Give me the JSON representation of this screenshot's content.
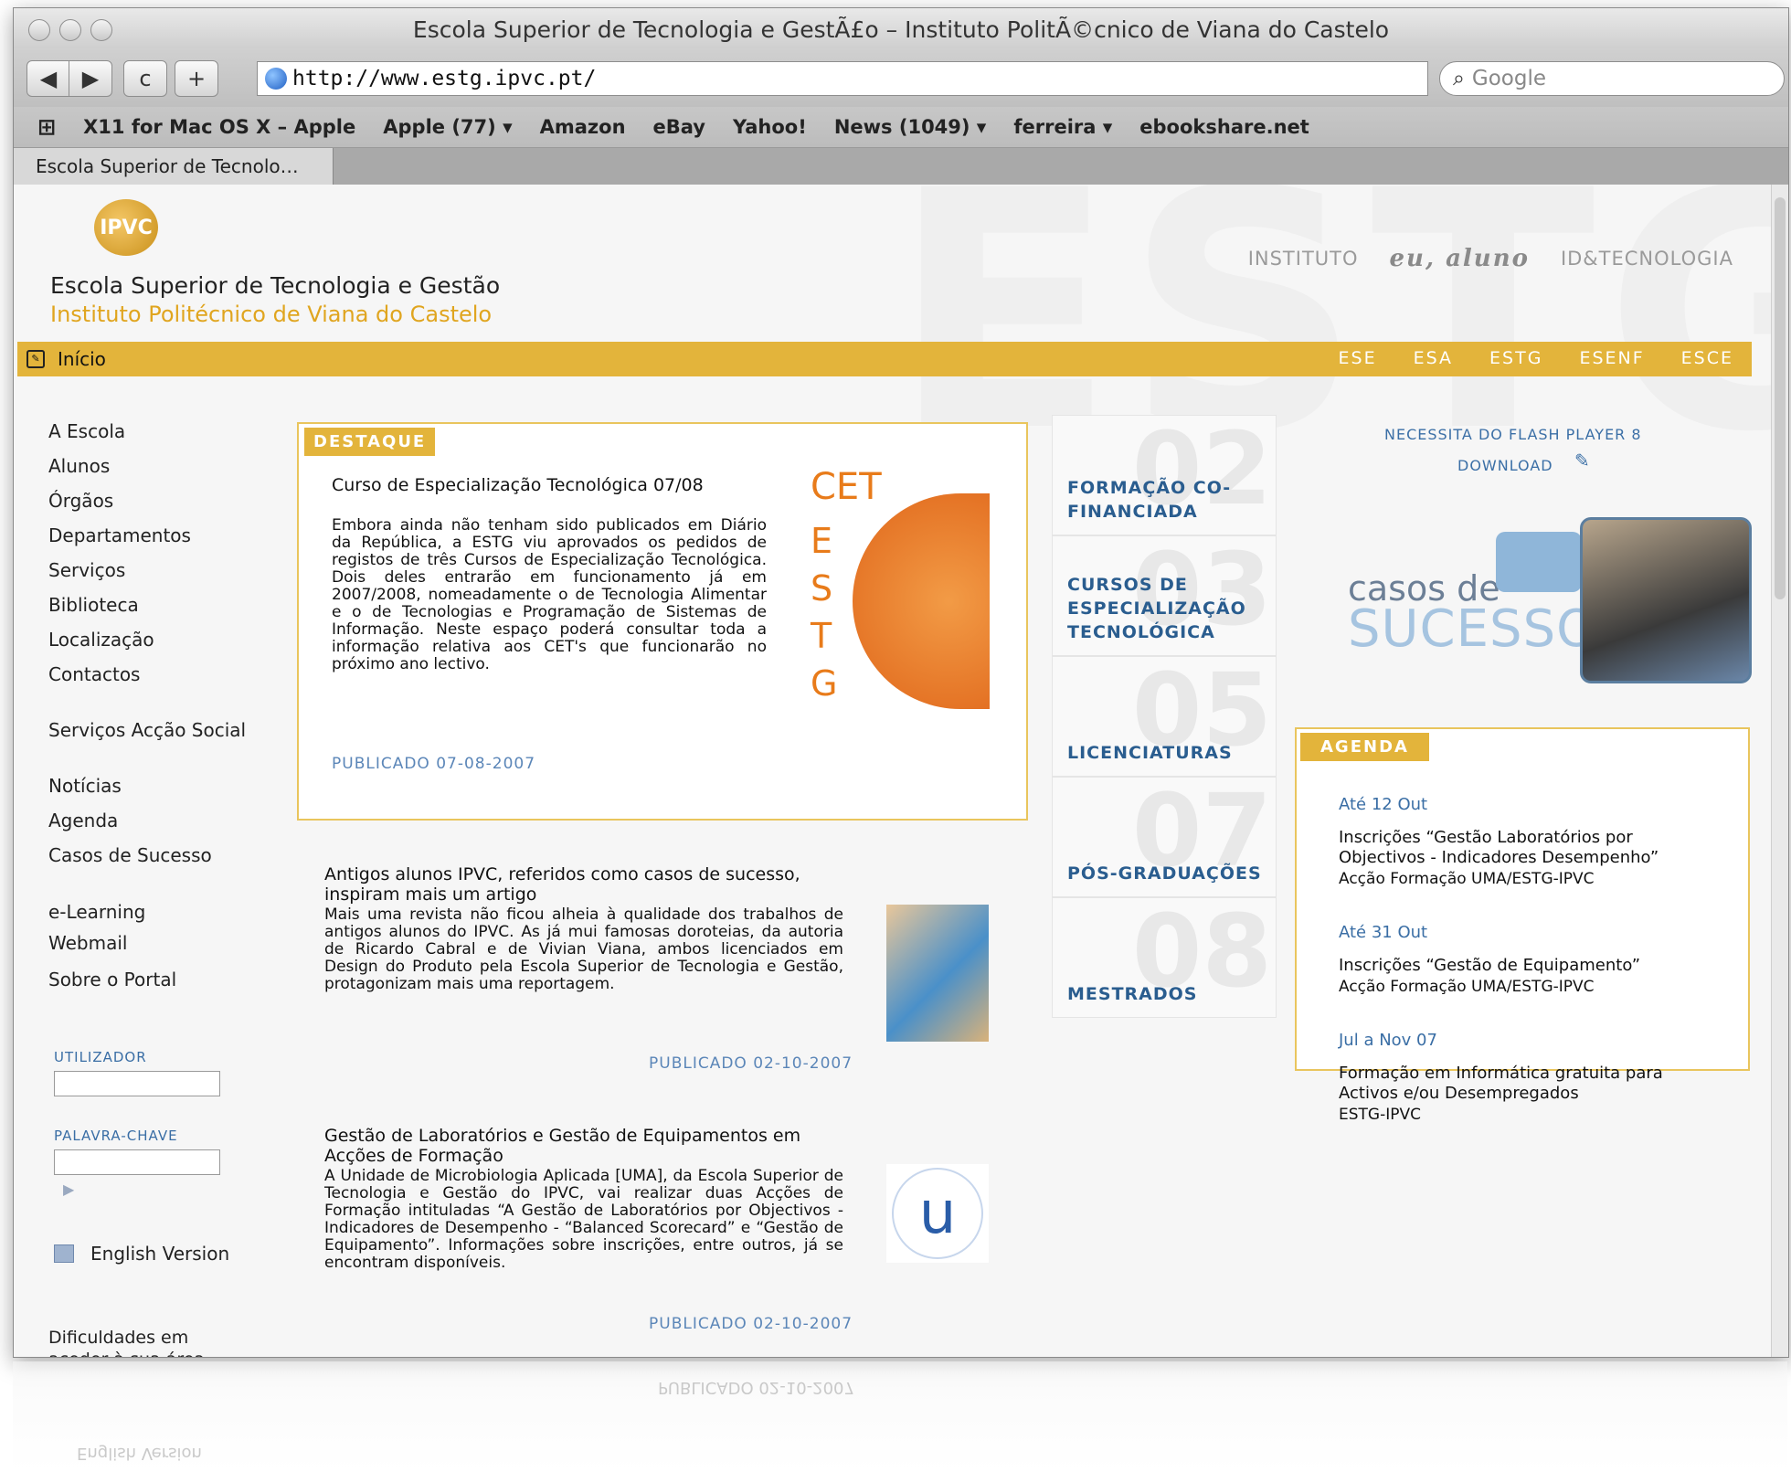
{
  "window": {
    "title": "Escola Superior de Tecnologia e GestÃ£o – Instituto PolitÃ©cnico de Viana do Castelo",
    "tab": "Escola Superior de Tecnolo…"
  },
  "toolbar": {
    "back": "◀",
    "forward": "▶",
    "reload": "c",
    "add": "+",
    "url": "http://www.estg.ipvc.pt/",
    "search_placeholder": "Google"
  },
  "bookmarks": [
    "X11 for Mac OS X – Apple",
    "Apple (77) ▾",
    "Amazon",
    "eBay",
    "Yahoo!",
    "News (1049) ▾",
    "ferreira ▾",
    "ebookshare.net"
  ],
  "site": {
    "logo_text": "IPVC",
    "bg_text": "ESTG",
    "name": "Escola Superior de Tecnologia e Gestão",
    "institute": "Instituto Politécnico de Viana do Castelo",
    "top_links": [
      "INSTITUTO",
      "eu, aluno",
      "ID&TECNOLOGIA"
    ],
    "home": "Início",
    "schools": [
      "ESE",
      "ESA",
      "ESTG",
      "ESENF",
      "ESCE"
    ]
  },
  "leftnav": {
    "items": [
      "A Escola",
      "Alunos",
      "Órgãos",
      "Departamentos",
      "Serviços",
      "Biblioteca",
      "Localização",
      "Contactos",
      "Serviços Acção Social",
      "Notícias",
      "Agenda",
      "Casos de Sucesso",
      "e-Learning",
      "Webmail",
      "Sobre o Portal"
    ],
    "user_label": "UTILIZADOR",
    "pass_label": "PALAVRA-CHAVE",
    "english": "English Version",
    "help": "Dificuldades em aceder à sua área"
  },
  "destaque": {
    "tag": "DESTAQUE",
    "title": "Curso de Especialização Tecnológica 07/08",
    "body": "Embora ainda não tenham sido publicados em Diário da República, a ESTG viu aprovados os pedidos de registos de três Cursos de Especialização Tecnológica. Dois deles entrarão em funcionamento já em 2007/2008, nomeadamente o de Tecnologia Alimentar e o de Tecnologias e Programação de Sistemas de Informação. Neste espaço poderá consultar toda a informação relativa aos CET's que funcionarão no próximo ano lectivo.",
    "published": "PUBLICADO 07-08-2007",
    "img_top": "CET",
    "img_letters": [
      "E",
      "S",
      "T",
      "G"
    ]
  },
  "news": [
    {
      "title": "Antigos alunos IPVC, referidos como casos de sucesso, inspiram mais um artigo",
      "body": "Mais uma revista não ficou alheia à qualidade dos trabalhos de antigos alunos do IPVC. As já mui famosas doroteias, da autoria de Ricardo Cabral e de Vivian Viana, ambos licenciados em Design do Produto pela Escola Superior de Tecnologia e Gestão, protagonizam mais uma reportagem.",
      "published": "PUBLICADO 02-10-2007"
    },
    {
      "title": "Gestão de Laboratórios e Gestão de Equipamentos em Acções de Formação",
      "body": "A Unidade de Microbiologia Aplicada [UMA], da Escola Superior de Tecnologia e Gestão do IPVC, vai realizar duas Acções de Formação intituladas “A Gestão de Laboratórios por Objectivos - Indicadores de Desempenho - “Balanced Scorecard” e “Gestão de Equipamento”. Informações sobre inscrições, entre outros, já se encontram disponíveis.",
      "published": "PUBLICADO 02-10-2007",
      "logo": "u"
    }
  ],
  "categories": [
    {
      "num": "02",
      "label": "FORMAÇÃO CO-FINANCIADA"
    },
    {
      "num": "03",
      "label": "CURSOS DE ESPECIALIZAÇÃO TECNOLÓGICA"
    },
    {
      "num": "05",
      "label": "LICENCIATURAS"
    },
    {
      "num": "07",
      "label": "PÓS-GRADUAÇÕES"
    },
    {
      "num": "08",
      "label": "MESTRADOS"
    }
  ],
  "right": {
    "flash": "NECESSITA DO FLASH PLAYER 8",
    "download": "DOWNLOAD",
    "casos_small": "casos de",
    "casos_big": "SUCESSO"
  },
  "agenda": {
    "tag": "AGENDA",
    "items": [
      {
        "date": "Até 12 Out",
        "title": "Inscrições “Gestão Laboratórios por Objectivos - Indicadores Desempenho”",
        "sub": "Acção Formação UMA/ESTG-IPVC"
      },
      {
        "date": "Até 31 Out",
        "title": "Inscrições “Gestão de Equipamento”",
        "sub": "Acção Formação UMA/ESTG-IPVC"
      },
      {
        "date": "Jul a Nov 07",
        "title": "Formação em Informática gratuita para Activos e/ou Desempregados",
        "sub": "ESTG-IPVC"
      }
    ]
  }
}
